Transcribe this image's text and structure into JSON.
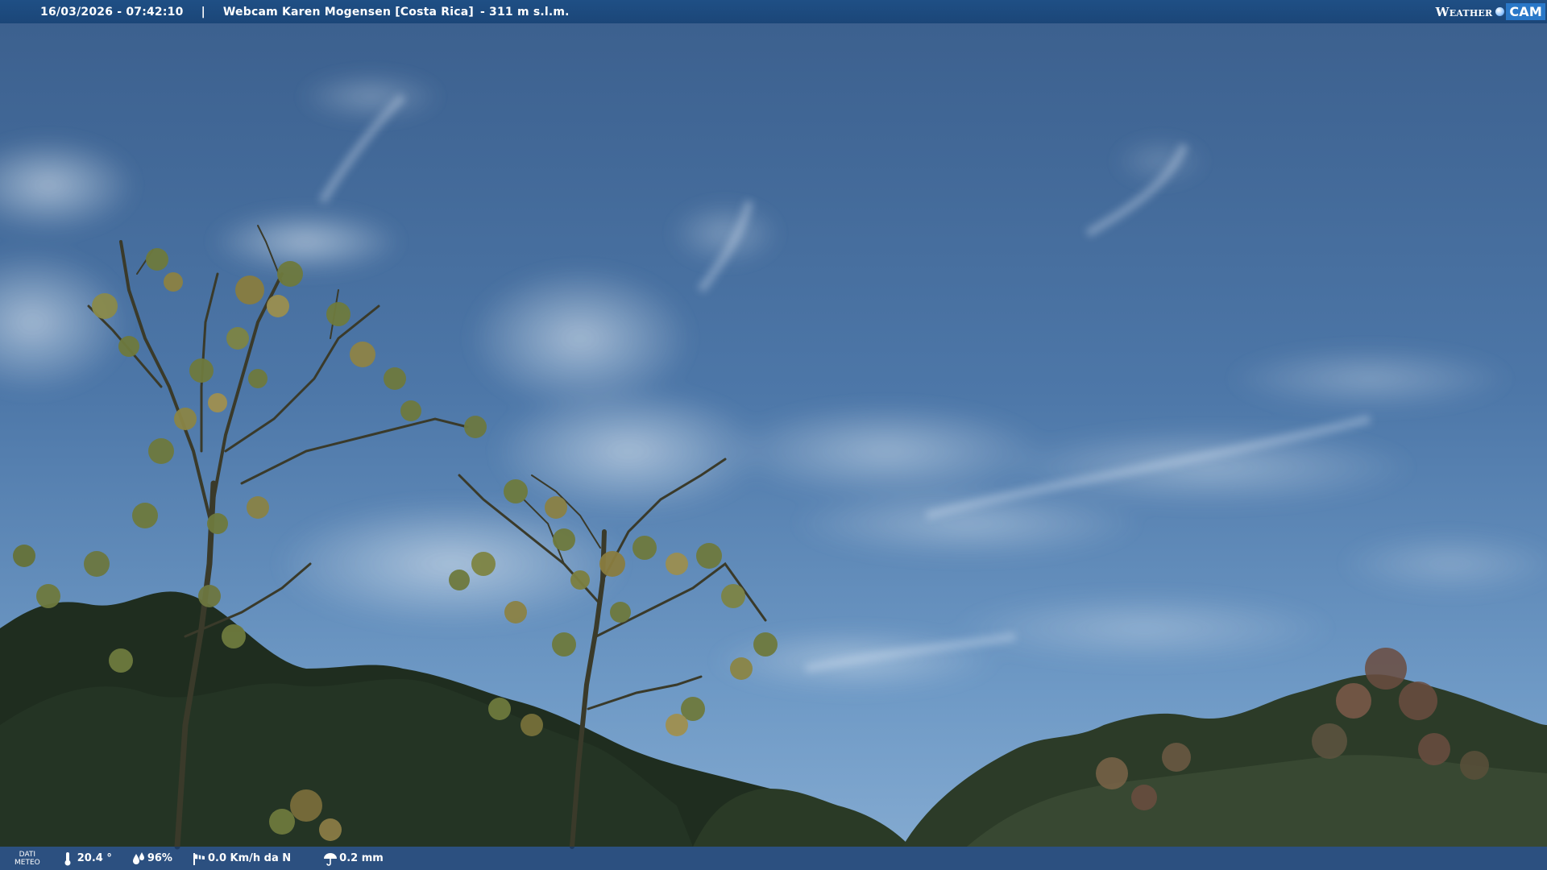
{
  "overlay": {
    "timestamp": "16/03/2026 - 07:42:10",
    "separator": "|",
    "camera_title": "Webcam Karen Mogensen [Costa Rica]",
    "altitude": "- 311 m s.l.m.",
    "logo_part1": "Weather",
    "logo_part2": "CAM"
  },
  "meteo": {
    "label_line1": "DATI",
    "label_line2": "METEO",
    "temperature": "20.4 °",
    "humidity": "96%",
    "wind": "0.0 Km/h da N",
    "rain": "0.2 mm",
    "icons": {
      "temperature": "thermometer-icon",
      "humidity": "droplets-icon",
      "wind": "windsock-icon",
      "rain": "umbrella-icon"
    }
  },
  "colors": {
    "bar_blue": "#1f4f85",
    "sky_top": "#3a5f8f",
    "sky_horizon": "#8fb3d6"
  }
}
